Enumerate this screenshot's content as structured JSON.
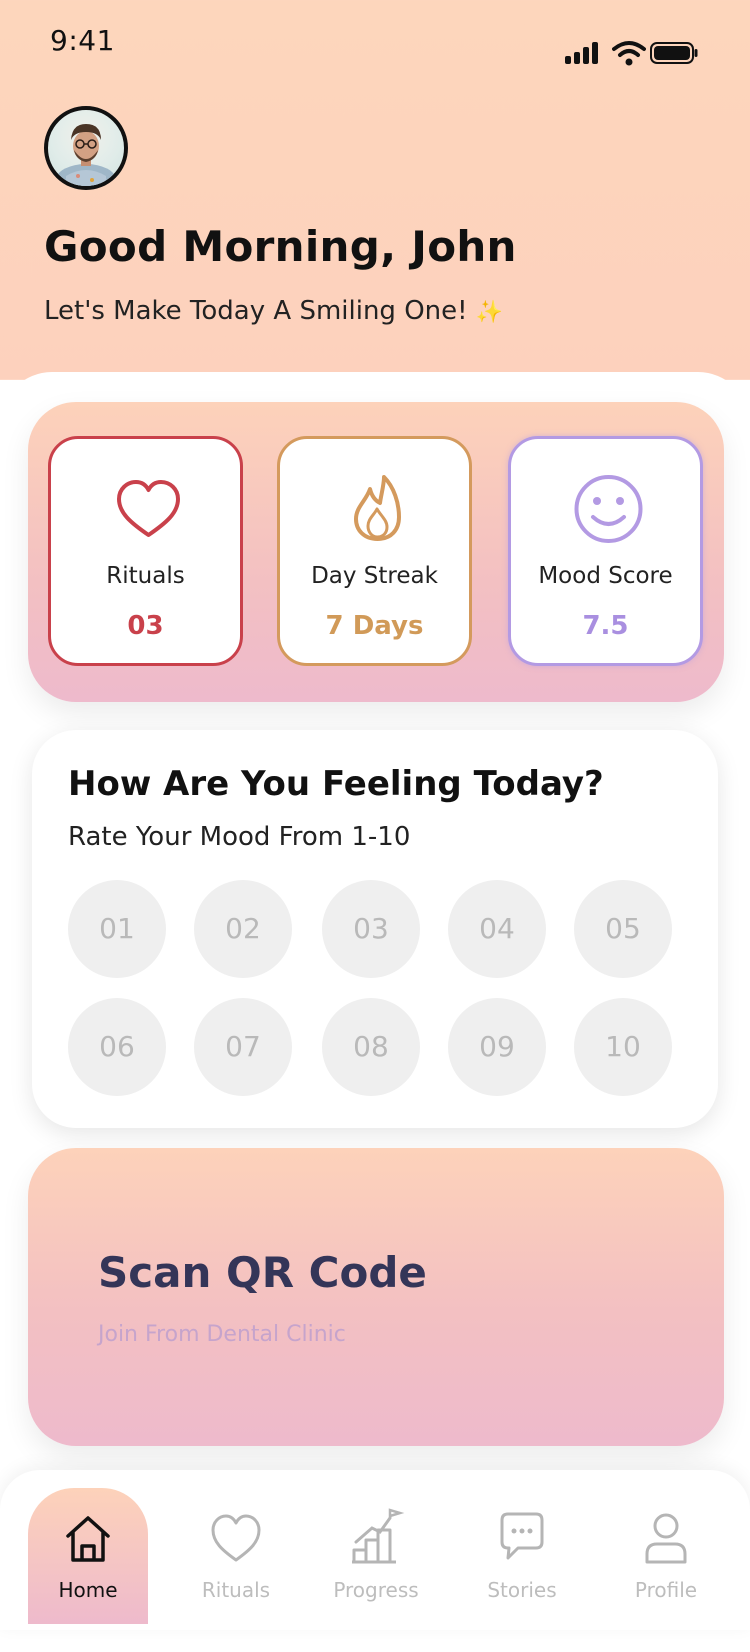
{
  "status_bar": {
    "time": "9:41"
  },
  "header": {
    "greeting": "Good Morning, John",
    "subtitle": "Let's Make Today A Smiling One!",
    "sparkle_icon": "sparkle-icon"
  },
  "stats": [
    {
      "label": "Rituals",
      "value": "03",
      "icon": "heart-icon",
      "color": "#c9414b"
    },
    {
      "label": "Day Streak",
      "value": "7 Days",
      "icon": "flame-icon",
      "color": "#d19a58"
    },
    {
      "label": "Mood Score",
      "value": "7.5",
      "icon": "smiley-icon",
      "color": "#a98fe0"
    }
  ],
  "mood": {
    "title": "How Are You Feeling Today?",
    "subtitle": "Rate Your Mood From 1-10",
    "options": [
      "01",
      "02",
      "03",
      "04",
      "05",
      "06",
      "07",
      "08",
      "09",
      "10"
    ]
  },
  "qr": {
    "title": "Scan QR Code",
    "subtitle": "Join From Dental Clinic"
  },
  "nav": [
    {
      "label": "Home",
      "icon": "home-icon",
      "active": true
    },
    {
      "label": "Rituals",
      "icon": "heart-icon",
      "active": false
    },
    {
      "label": "Progress",
      "icon": "progress-chart-icon",
      "active": false
    },
    {
      "label": "Stories",
      "icon": "chat-bubble-icon",
      "active": false
    },
    {
      "label": "Profile",
      "icon": "user-icon",
      "active": false
    }
  ],
  "colors": {
    "header_bg": "#fdd6bc",
    "accent_gradient_top": "#fdd2ba",
    "accent_gradient_bottom": "#eebacc",
    "qr_title": "#343558",
    "qr_subtitle": "#c6a4cc"
  }
}
